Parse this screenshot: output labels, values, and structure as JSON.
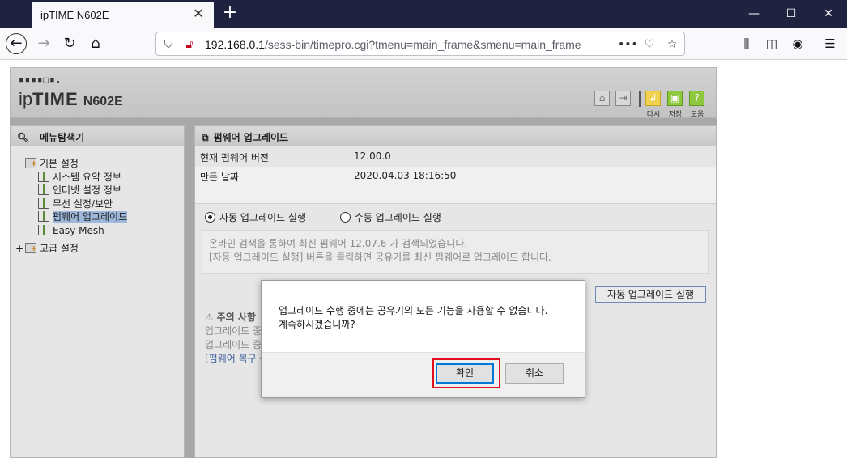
{
  "browser": {
    "tab_title": "ipTIME N602E",
    "url_host": "192.168.0.1",
    "url_path": "/sess-bin/timepro.cgi?tmenu=main_frame&smenu=main_frame",
    "icons": [
      "back-arrow",
      "forward-arrow",
      "reload",
      "home",
      "shield",
      "insecure-lock",
      "page-actions",
      "pocket",
      "bookmark-star",
      "library",
      "sidebar",
      "account",
      "menu"
    ]
  },
  "router": {
    "logo_dots": "▪▪▪▪□▪.",
    "logo_ip": "ip",
    "logo_time": "TIME",
    "logo_model": "N602E",
    "header_buttons": [
      {
        "icon": "home-icon"
      },
      {
        "icon": "logout-icon"
      },
      {
        "icon": "back-icon",
        "label": "다시"
      },
      {
        "icon": "save-icon",
        "label": "저장"
      },
      {
        "icon": "help-icon",
        "label": "도움"
      }
    ]
  },
  "sidebar": {
    "title": "메뉴탐색기",
    "items": [
      {
        "label": "기본 설정",
        "level": 0,
        "type": "folder"
      },
      {
        "label": "시스템 요약 정보",
        "level": 1,
        "type": "leaf"
      },
      {
        "label": "인터넷 설정 정보",
        "level": 1,
        "type": "leaf"
      },
      {
        "label": "무선 설정/보안",
        "level": 1,
        "type": "leaf"
      },
      {
        "label": "펌웨어 업그레이드",
        "level": 1,
        "type": "leaf",
        "selected": true
      },
      {
        "label": "Easy Mesh",
        "level": 1,
        "type": "leaf"
      },
      {
        "label": "고급 설정",
        "level": 0,
        "type": "folder",
        "expander": "+"
      }
    ]
  },
  "main": {
    "title": "펌웨어 업그레이드",
    "rows": [
      {
        "key": "현재 펌웨어 버전",
        "value": "12.00.0"
      },
      {
        "key": "만든 날짜",
        "value": "2020.04.03 18:16:50"
      }
    ],
    "radio_auto": "자동 업그레이드 실행",
    "radio_manual": "수동 업그레이드 실행",
    "notice_line1": "온라인 검색을 통하여 최신 펌웨어 12.07.6 가 검색되었습니다.",
    "notice_line2": "[자동 업그레이드 실행] 버튼을 클릭하면 공유기를 최신 펌웨어로 업그레이드 합니다.",
    "auto_button": "자동 업그레이드 실행",
    "caution_title": "주의 사항",
    "caution_line1": "업그레이드 중",
    "caution_line2": "업그레이드 중",
    "caution_line3": "[펌웨어 복구 수"
  },
  "dialog": {
    "message_line1": "업그레이드 수행 중에는 공유기의 모든 기능을 사용할 수 없습니다.",
    "message_line2": "계속하시겠습니까?",
    "ok_label": "확인",
    "cancel_label": "취소",
    "highlight_color": "#e01020"
  }
}
